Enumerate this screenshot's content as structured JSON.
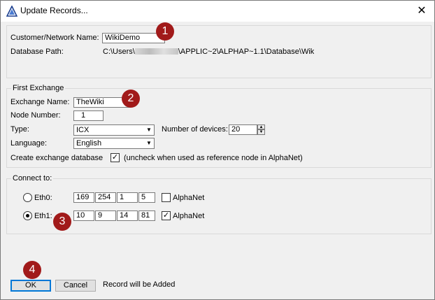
{
  "window": {
    "title": "Update Records...",
    "close_glyph": "✕",
    "app_icon": "triangle-app-icon"
  },
  "customer": {
    "name_label": "Customer/Network Name:",
    "name_value": "WikiDemo",
    "path_label": "Database Path:",
    "path_prefix": "C:\\Users\\",
    "path_suffix": "\\APPLIC~2\\ALPHAP~1.1\\Database\\Wik"
  },
  "exchange": {
    "legend": "First Exchange",
    "name_label": "Exchange Name:",
    "name_value": "TheWiki",
    "node_label": "Node Number:",
    "node_value": "1",
    "type_label": "Type:",
    "type_value": "ICX",
    "devices_label": "Number of devices:",
    "devices_value": "20",
    "language_label": "Language:",
    "language_value": "English",
    "create_label": "Create exchange database",
    "create_checked": true,
    "create_note": "(uncheck when used as reference node in AlphaNet)"
  },
  "connect": {
    "legend": "Connect to:",
    "eth0": {
      "label": "Eth0:",
      "selected": false,
      "ip": [
        "169",
        "254",
        "1",
        "5"
      ],
      "alphanet_label": "AlphaNet",
      "alphanet_checked": false
    },
    "eth1": {
      "label": "Eth1:",
      "selected": true,
      "ip": [
        "10",
        "9",
        "14",
        "81"
      ],
      "alphanet_label": "AlphaNet",
      "alphanet_checked": true
    }
  },
  "footer": {
    "ok_label": "OK",
    "cancel_label": "Cancel",
    "status": "Record will be Added"
  },
  "annotations": [
    "1",
    "2",
    "3",
    "4"
  ],
  "colors": {
    "badge": "#a11a1a",
    "default_button_border": "#0078d7"
  }
}
